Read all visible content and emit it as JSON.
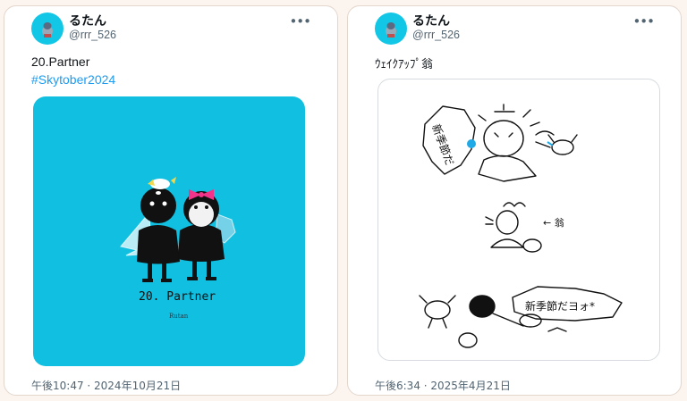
{
  "tweets": [
    {
      "user": {
        "name": "るたん",
        "handle": "@rrr_526"
      },
      "text": "20.Partner",
      "hashtag": "#Skytober2024",
      "image": {
        "caption": "20. Partner",
        "signature": "Rutan"
      },
      "timestamp": "午後10:47 · 2024年10月21日"
    },
    {
      "user": {
        "name": "るたん",
        "handle": "@rrr_526"
      },
      "text": "ｳｪｲｸｱｯﾌﾟ翁",
      "image": {
        "bubble_left": "新季節だ",
        "bubble_right": "新季節だヨォ*",
        "arrow_label": "← 翁"
      },
      "timestamp": "午後6:34 · 2025年4月21日"
    }
  ],
  "icons": {
    "more": "more-horizontal-icon",
    "avatar": "avatar-image"
  },
  "colors": {
    "cyan": "#11bfe0",
    "link": "#1d9bf0",
    "muted": "#536471",
    "page_bg": "#fcf4ee"
  }
}
